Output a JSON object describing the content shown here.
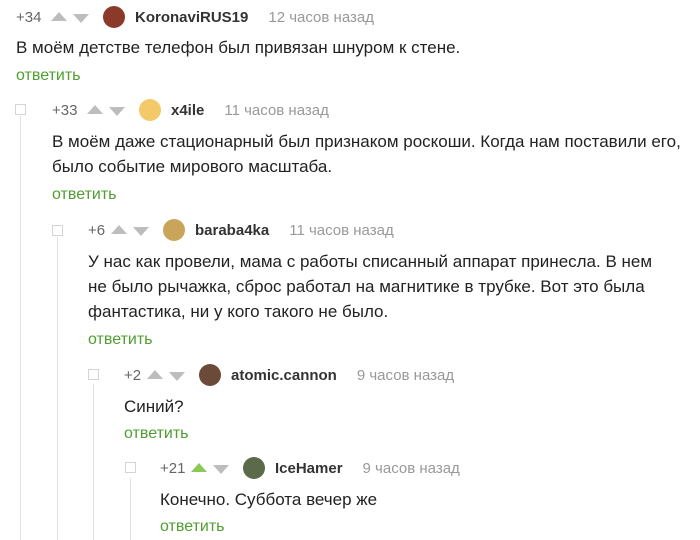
{
  "comments": [
    {
      "rating": "+34",
      "username": "KoronaviRUS19",
      "time": "12 часов назад",
      "text": "В моём детстве телефон был привязан шнуром к стене.",
      "reply_label": "ответить",
      "avatar_color": "#8b3a2a",
      "upvoted": false
    },
    {
      "rating": "+33",
      "username": "x4ile",
      "time": "11 часов назад",
      "text": "В моём даже стационарный был признаком роскоши. Когда нам поставили его, было событие мирового масштаба.",
      "reply_label": "ответить",
      "avatar_color": "#f3c969",
      "upvoted": false
    },
    {
      "rating": "+6",
      "username": "baraba4ka",
      "time": "11 часов назад",
      "text": "У нас как провели, мама с работы списанный аппарат принесла. В нем не было рычажка, сброс работал на магнитике в трубке. Вот это была фантастика, ни у кого такого не было.",
      "reply_label": "ответить",
      "avatar_color": "#c9a55a",
      "upvoted": false
    },
    {
      "rating": "+2",
      "username": "atomic.cannon",
      "time": "9 часов назад",
      "text": "Синий?",
      "reply_label": "ответить",
      "avatar_color": "#6b4a3a",
      "upvoted": false
    },
    {
      "rating": "+21",
      "username": "IceHamer",
      "time": "9 часов назад",
      "text": "Конечно. Суббота вечер же",
      "reply_label": "ответить",
      "avatar_color": "#5a6a4a",
      "upvoted": true
    }
  ],
  "colors": {
    "reply_green": "#4f9e2f",
    "upvote_active": "#8ac858",
    "arrow_inactive": "#bdbdbd"
  }
}
